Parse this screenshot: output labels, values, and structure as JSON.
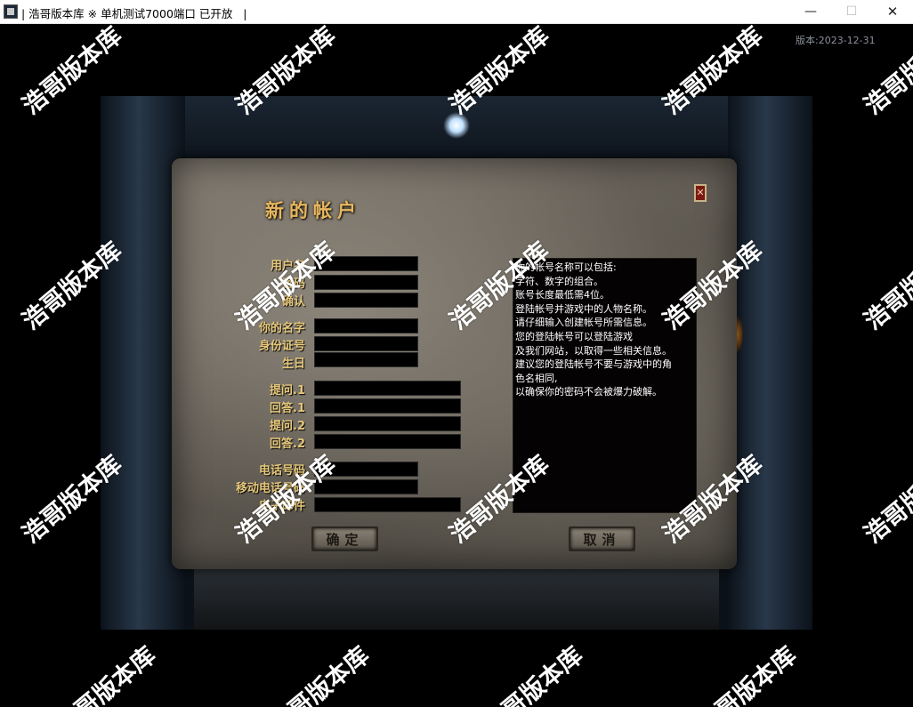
{
  "window": {
    "title": "| 浩哥版本库 ※ 单机测试7000端口 已开放   |",
    "minimize": "—",
    "maximize": "☐",
    "close": "✕"
  },
  "version_label": "版本:2023-12-31",
  "dialog": {
    "title": "新的帐户",
    "close_glyph": "✕",
    "fields": [
      {
        "label": "用户名"
      },
      {
        "label": "密码"
      },
      {
        "label": "确认"
      },
      {
        "label": "你的名字"
      },
      {
        "label": "身份证号"
      },
      {
        "label": "生日"
      },
      {
        "label": "提问.1"
      },
      {
        "label": "回答.1"
      },
      {
        "label": "提问.2"
      },
      {
        "label": "回答.2"
      },
      {
        "label": "电话号码"
      },
      {
        "label": "移动电话号码"
      },
      {
        "label": "电子邮件"
      }
    ],
    "info_lines": [
      "你的帐号名称可以包括:",
      "字符、数字的组合。",
      "账号长度最低需4位。",
      "登陆帐号并游戏中的人物名称。",
      "请仔细输入创建帐号所需信息。",
      "您的登陆帐号可以登陆游戏",
      "及我们网站，以取得一些相关信息。",
      "建议您的登陆帐号不要与游戏中的角",
      "色名相同,",
      "以确保你的密码不会被爆力破解。"
    ],
    "ok_button": "确定",
    "cancel_button": "取消"
  },
  "watermark": "浩哥版本库"
}
